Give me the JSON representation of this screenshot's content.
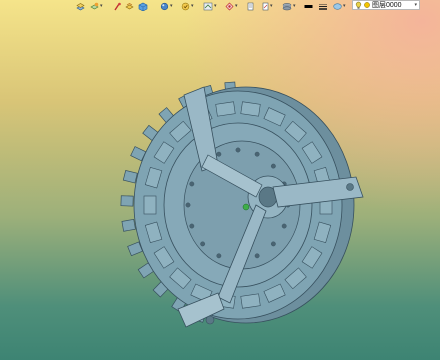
{
  "toolbar": {
    "items": [
      {
        "icon": "layer-manager-icon"
      },
      {
        "icon": "layer-state-icon"
      },
      {
        "icon": "match-properties-icon"
      },
      {
        "icon": "isolate-layer-icon"
      },
      {
        "icon": "layer-color-icon"
      },
      {
        "icon": "layer-freeze-icon"
      },
      {
        "icon": "layer-walk-icon"
      },
      {
        "icon": "layer-off-icon"
      },
      {
        "icon": "layer-lock-icon"
      },
      {
        "icon": "layer-previous-icon"
      },
      {
        "icon": "layer-plot-icon"
      },
      {
        "icon": "color-black-swatch-icon"
      },
      {
        "icon": "linetype-icon"
      }
    ],
    "layer_selector": {
      "current": "图层0000",
      "bulb_color": "#e8d24a",
      "sun_color": "#f2c400"
    }
  },
  "viewport": {
    "model": "clutch-disc-assembly-wireframe",
    "model_color": "#7fa4b3",
    "edge_color": "#37505e"
  }
}
